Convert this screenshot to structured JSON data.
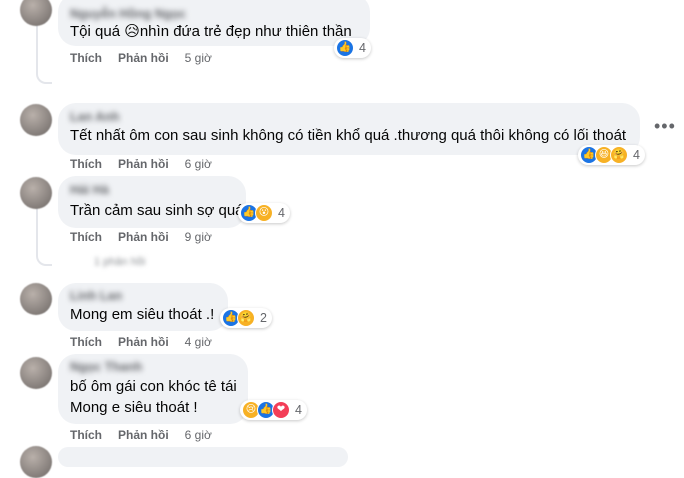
{
  "actions": {
    "like_label": "Thích",
    "reply_label": "Phản hồi"
  },
  "comments": [
    {
      "author": "Nguyễn Hồng Ngọc",
      "lines": [
        "Tội quá 😥nhìn đứa trẻ đẹp như thiên thần"
      ],
      "time": "5 giờ",
      "reaction_count": "4",
      "reactions": [
        "like-icon"
      ]
    },
    {
      "author": "Lan Anh",
      "lines": [
        "Tết nhất ôm con sau sinh không có tiền khổ quá .thương quá thôi không có lối thoát"
      ],
      "time": "6 giờ",
      "reaction_count": "4",
      "reactions": [
        "like-icon",
        "haha-icon",
        "care-icon"
      ]
    },
    {
      "author": "Hải Hà",
      "lines": [
        "Trần cảm sau sinh sợ quá"
      ],
      "time": "9 giờ",
      "reaction_count": "4",
      "reactions": [
        "like-icon",
        "wow-icon"
      ]
    },
    {
      "author": "Linh Lan",
      "lines": [
        "Mong em siêu thoát .!"
      ],
      "time": "4 giờ",
      "reaction_count": "2",
      "reactions": [
        "like-icon",
        "care-icon"
      ]
    },
    {
      "author": "Ngọc Thanh",
      "lines": [
        "bố ôm gái con khóc tê tái",
        "Mong e siêu thoát !"
      ],
      "time": "6 giờ",
      "reaction_count": "4",
      "reactions": [
        "sad-icon",
        "like-icon",
        "love-icon"
      ]
    }
  ],
  "reply_hints": [
    "1 phản hồi",
    "1 phản hồi"
  ],
  "icons": {
    "more": "more-options-icon"
  },
  "colors": {
    "bubble": "#f0f2f5",
    "meta": "#65676b",
    "like": "#1b74e4",
    "love": "#f33e58",
    "yellow": "#f7b125"
  }
}
